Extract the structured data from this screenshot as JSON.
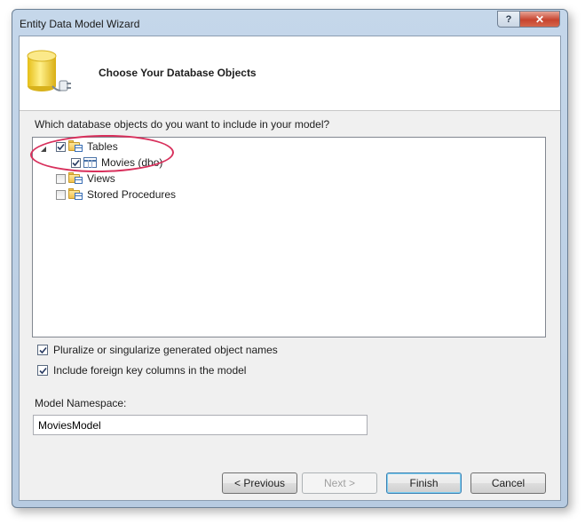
{
  "window": {
    "title": "Entity Data Model Wizard",
    "help_glyph": "?",
    "close_glyph": "✕"
  },
  "header": {
    "title": "Choose Your Database Objects",
    "icon": "database-connector-icon"
  },
  "prompt": "Which database objects do you want to include in your model?",
  "tree": {
    "tables": {
      "label": "Tables",
      "checked": true,
      "expanded": true
    },
    "movies": {
      "label": "Movies (dbo)",
      "checked": true
    },
    "views": {
      "label": "Views",
      "checked": false
    },
    "procedures": {
      "label": "Stored Procedures",
      "checked": false
    }
  },
  "options": {
    "pluralize": {
      "label": "Pluralize or singularize generated object names",
      "checked": true
    },
    "foreign_keys": {
      "label": "Include foreign key columns in the model",
      "checked": true
    }
  },
  "namespace": {
    "label": "Model Namespace:",
    "value": "MoviesModel"
  },
  "buttons": {
    "previous": "< Previous",
    "next": "Next >",
    "finish": "Finish",
    "cancel": "Cancel"
  },
  "colors": {
    "highlight_ellipse": "#d8305c",
    "window_frame": "#b7cbe1",
    "close_button": "#c7442f"
  }
}
